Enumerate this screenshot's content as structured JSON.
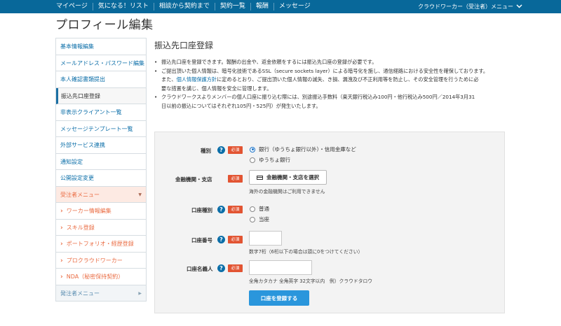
{
  "topbar": {
    "nav": [
      "マイページ",
      "気になる！リスト",
      "相談から契約まで",
      "契約一覧",
      "報酬",
      "メッセージ"
    ],
    "user_label": "クラウドワーカー（受注者）メニュー",
    "chevron": "chevron-down-icon"
  },
  "page_title": "プロフィール編集",
  "sidebar": {
    "items": [
      {
        "label": "基本情報編集"
      },
      {
        "label": "メールアドレス・パスワード編集"
      },
      {
        "label": "本人確認書類提出"
      },
      {
        "label": "振込先口座登録"
      },
      {
        "label": "非表示クライアント一覧"
      },
      {
        "label": "メッセージテンプレート一覧"
      },
      {
        "label": "外部サービス連携"
      },
      {
        "label": "通知設定"
      },
      {
        "label": "公開設定変更"
      }
    ],
    "worker_menu": {
      "label": "受注者メニュー",
      "arrow": "▼",
      "items": [
        {
          "label": "ワーカー情報編集"
        },
        {
          "label": "スキル登録"
        },
        {
          "label": "ポートフォリオ・経歴登録"
        },
        {
          "label": "プロクラウドワーカー"
        },
        {
          "label": "NDA（秘密保持契約）"
        }
      ]
    },
    "client_menu": {
      "label": "発注者メニュー",
      "arrow": "▶"
    }
  },
  "main": {
    "heading": "振込先口座登録",
    "bullets": {
      "b1": "振込先口座を登録できます。報酬の出金や、返金依頼をするには振込先口座の登録が必要です。",
      "b2_l1": "ご提出頂いた個人情報は、暗号化技術であるSSL（secure sockets layer）による暗号化を施し、通信経路における安全性を確保しております。",
      "b2_l2_pre": "また、",
      "b2_link": "個人情報保護方針",
      "b2_l2_post": "に定めるとおり、ご提出頂いた個人情報の滅失、き損、漏洩及び不正利用等を防止し、その安全管理を行うために必",
      "b2_l3": "要な措置を講じ、個人情報を安全に管理します。",
      "b3_l1": "クラウドワークスよりメンバーの個人口座に振り込む際には、別途振込手数料（楽天銀行税込み100円・他行税込み500円／2014年3月31",
      "b3_l2": "日以前の振込についてはそれぞれ105円・525円）が発生いたします。"
    }
  },
  "form": {
    "help_glyph": "?",
    "required": "必須",
    "type": {
      "label": "種別",
      "options": [
        "銀行（ゆうちょ銀行以外）・信用金庫など",
        "ゆうちょ銀行"
      ],
      "selected": 0
    },
    "bank": {
      "label": "金融機関・支店",
      "button": "金融機関・支店を選択",
      "note": "海外の金融機関はご利用できません"
    },
    "account_type": {
      "label": "口座種別",
      "options": [
        "普通",
        "当座"
      ]
    },
    "account_number": {
      "label": "口座番号",
      "value": "",
      "note": "数字7桁（6桁以下の場合は頭に0をつけてください）"
    },
    "account_name": {
      "label": "口座名義人",
      "value": "",
      "note": "全角カタカナ 全角英字 32文字以内　例）クラウドタロウ"
    },
    "submit": "口座を登録する"
  }
}
